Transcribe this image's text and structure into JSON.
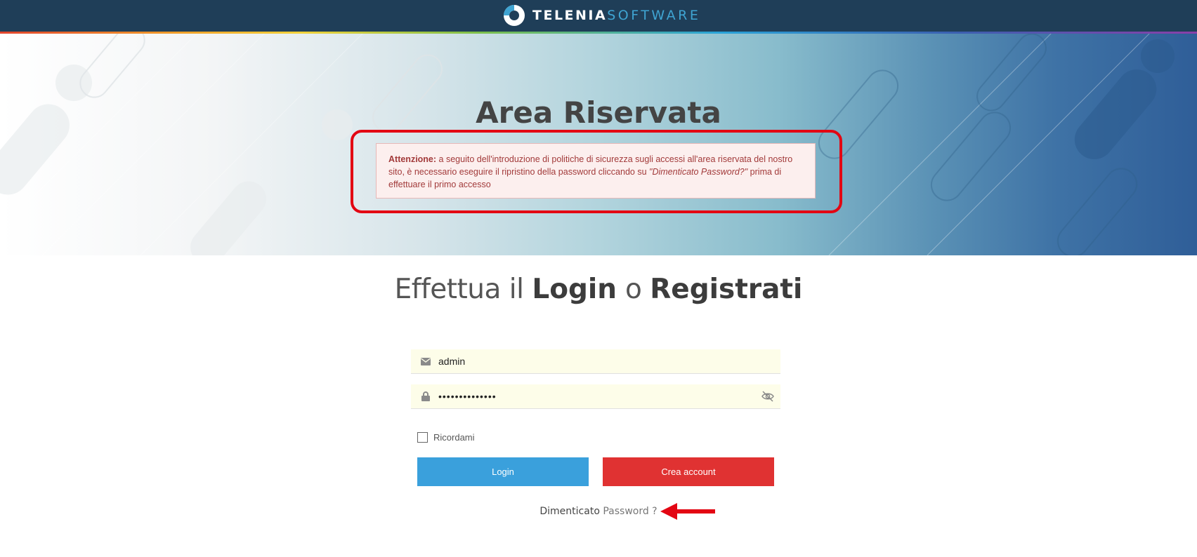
{
  "header": {
    "brand_bold": "TELENIA",
    "brand_light": "SOFTWARE"
  },
  "hero": {
    "title": "Area Riservata",
    "alert": {
      "label": "Attenzione:",
      "text_before": " a seguito dell'introduzione di politiche di sicurezza sugli accessi all'area riservata del nostro sito, è necessario eseguire il ripristino della password cliccando su ",
      "link_text": "\"Dimenticato Password?\"",
      "text_after": " prima di effettuare il primo accesso"
    }
  },
  "login": {
    "heading_part1": "Effettua il ",
    "heading_login": "Login",
    "heading_part2": " o ",
    "heading_register": "Registrati",
    "email_value": "admin",
    "password_value": "••••••••••••••",
    "remember_label": "Ricordami",
    "login_button": "Login",
    "create_button": "Crea account",
    "forgot_part1": "Dimenticato",
    "forgot_part2": " Password ?"
  },
  "colors": {
    "topbar": "#1f3e58",
    "login_button": "#3aa0dc",
    "create_button": "#e03232",
    "highlight": "#e30613"
  },
  "icons": {
    "email": "envelope-icon",
    "password": "lock-icon",
    "toggle_password": "eye-slash-icon",
    "arrow": "arrow-left-icon"
  }
}
